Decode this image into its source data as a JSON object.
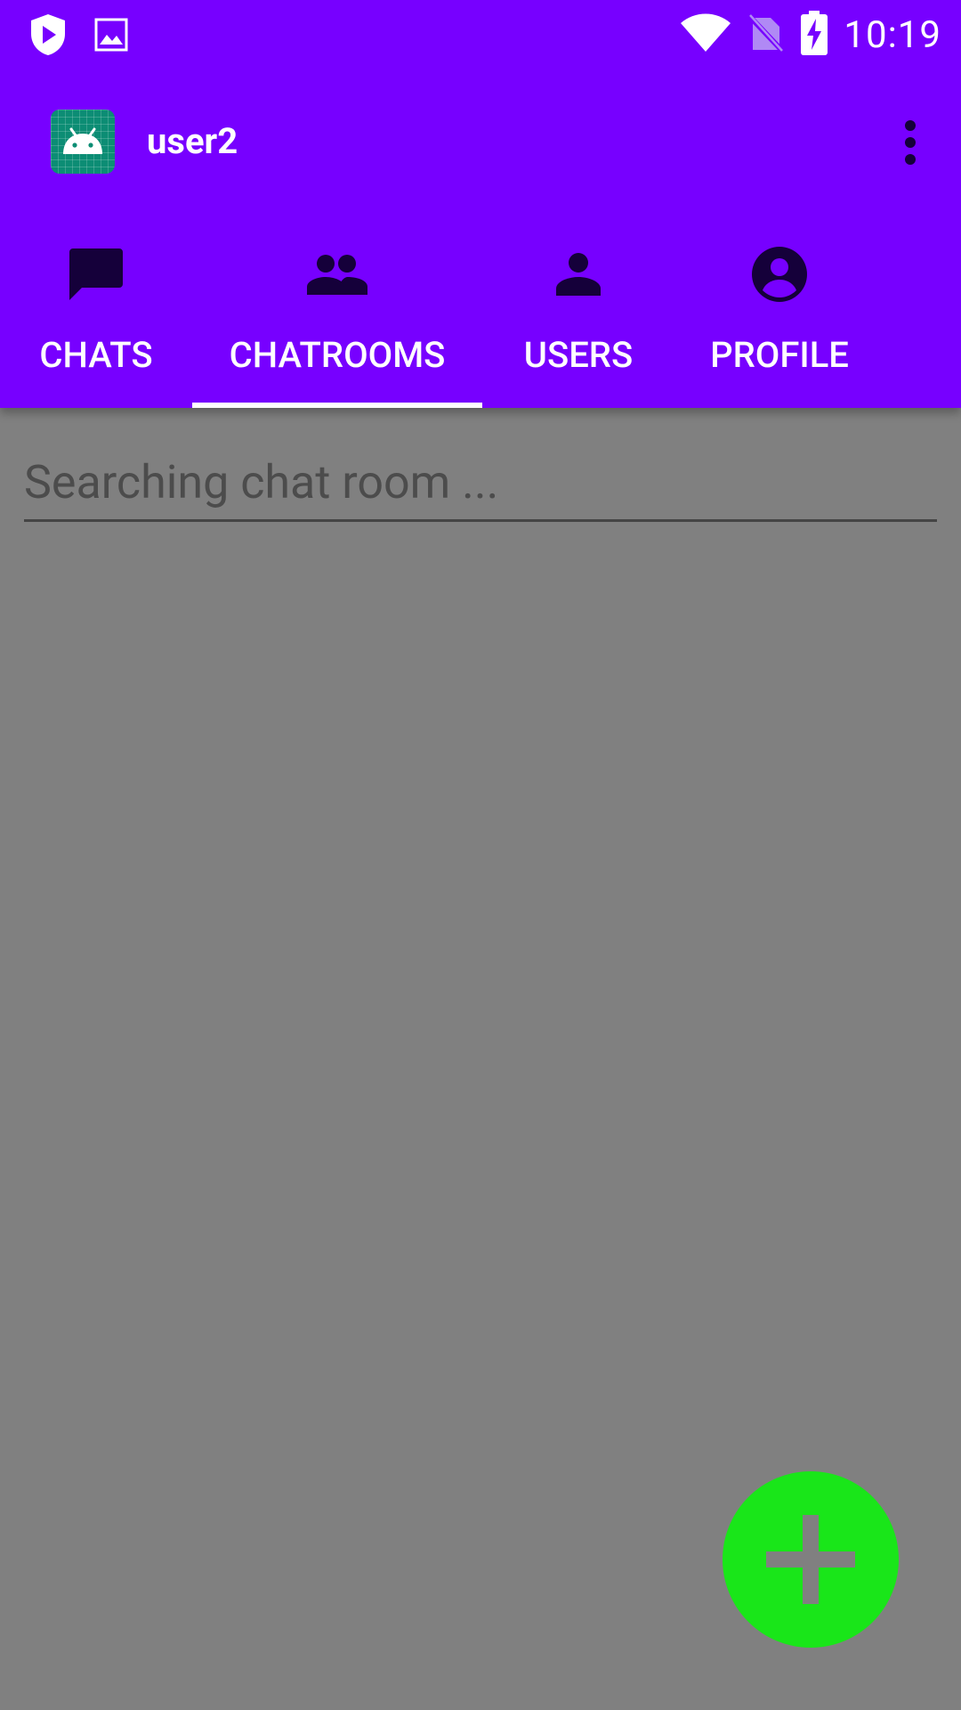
{
  "status_bar": {
    "time": "10:19",
    "icons": [
      "play-protect-icon",
      "image-notification-icon",
      "wifi-icon",
      "no-sim-icon",
      "battery-charging-icon"
    ]
  },
  "app_bar": {
    "title": "user2",
    "logo": "android-icon",
    "menu": "overflow-menu-icon"
  },
  "tabs": [
    {
      "label": "CHATS",
      "icon": "chat-icon",
      "selected": false
    },
    {
      "label": "CHATROOMS",
      "icon": "group-icon",
      "selected": true
    },
    {
      "label": "USERS",
      "icon": "person-icon",
      "selected": false
    },
    {
      "label": "PROFILE",
      "icon": "account-circle-icon",
      "selected": false
    }
  ],
  "search": {
    "placeholder": "Searching chat room ...",
    "value": ""
  },
  "fab": {
    "icon": "plus-icon"
  },
  "colors": {
    "primary": "#7700FF",
    "icon_dark": "#15003A",
    "fab": "#19E619",
    "scrim": "#808080"
  }
}
